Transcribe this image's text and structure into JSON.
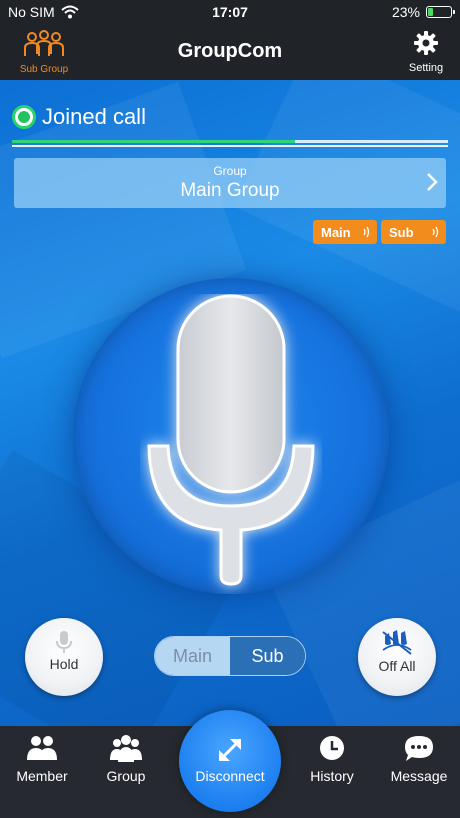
{
  "status_bar": {
    "carrier": "No SIM",
    "time": "17:07",
    "battery": "23%",
    "battery_level": 0.23
  },
  "nav": {
    "title": "GroupCom",
    "left_label": "Sub Group",
    "right_label": "Setting"
  },
  "call": {
    "status": "Joined call",
    "level": 0.65,
    "group_caption": "Group",
    "group_name": "Main Group"
  },
  "badges": {
    "main": "Main",
    "sub": "Sub"
  },
  "controls": {
    "hold": "Hold",
    "off_all": "Off All",
    "segment_main": "Main",
    "segment_sub": "Sub",
    "segment_selected": "Sub"
  },
  "tabs": {
    "member": "Member",
    "group": "Group",
    "disconnect": "Disconnect",
    "history": "History",
    "message": "Message"
  },
  "colors": {
    "accent_orange": "#f28c1c",
    "status_green": "#22c45e",
    "main_blue": "#1a8ae6",
    "dark_bar": "#202328"
  }
}
